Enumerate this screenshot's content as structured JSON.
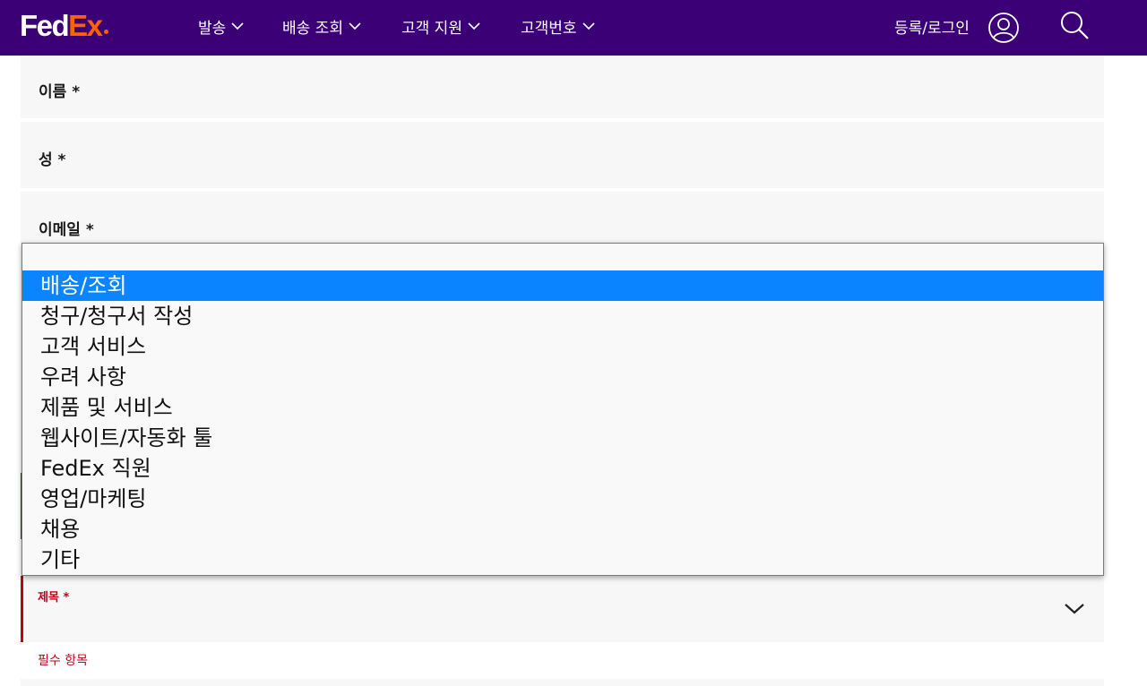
{
  "header": {
    "logo_fed": "Fed",
    "logo_ex": "Ex",
    "nav": [
      {
        "label": "발송"
      },
      {
        "label": "배송 조회"
      },
      {
        "label": "고객 지원"
      },
      {
        "label": "고객번호"
      }
    ],
    "login_label": "등록/로그인"
  },
  "form": {
    "first_name_label": "이름 *",
    "last_name_label": "성 *",
    "email_label": "이메일 *",
    "subject_label": "제목 *",
    "required_message": "필수 항목"
  },
  "dropdown": {
    "options": [
      "배송/조회",
      "청구/청구서 작성",
      "고객 서비스",
      "우려 사항",
      "제품 및 서비스",
      "웹사이트/자동화 툴",
      "FedEx 직원",
      "영업/마케팅",
      "채용",
      "기타"
    ],
    "selected_index": 0
  },
  "colors": {
    "header_bg": "#3b0075",
    "brand_orange": "#ff6200",
    "error_red": "#c0001a",
    "selected_option_bg": "#0a84ff"
  }
}
